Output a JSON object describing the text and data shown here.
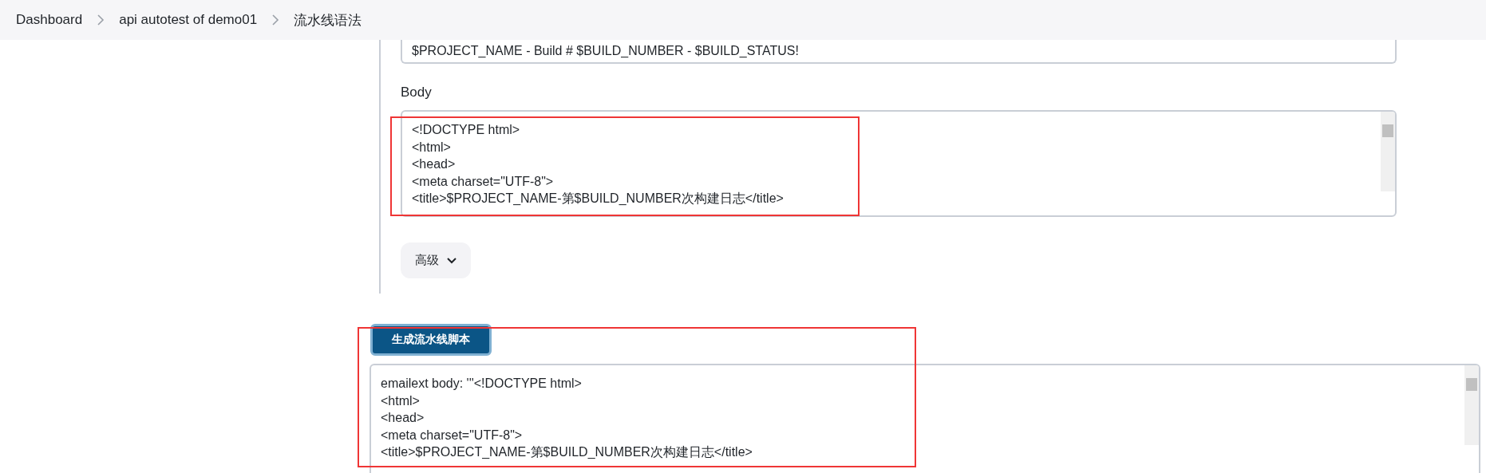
{
  "breadcrumb": [
    {
      "label": "Dashboard"
    },
    {
      "label": "api autotest of demo01"
    },
    {
      "label": "流水线语法"
    }
  ],
  "subject": {
    "value": "$PROJECT_NAME - Build # $BUILD_NUMBER - $BUILD_STATUS!"
  },
  "body": {
    "label": "Body",
    "lines": [
      "<!DOCTYPE html>",
      "<html>",
      "<head>",
      "<meta charset=\"UTF-8\">",
      "<title>$PROJECT_NAME-第$BUILD_NUMBER次构建日志</title>"
    ]
  },
  "advanced_button": {
    "label": "高级"
  },
  "generate_button": {
    "label": "生成流水线脚本"
  },
  "output": {
    "lines": [
      "emailext body: '''<!DOCTYPE html>",
      "<html>",
      "<head>",
      "<meta charset=\"UTF-8\">",
      "<title>$PROJECT_NAME-第$BUILD_NUMBER次构建日志</title>"
    ]
  }
}
